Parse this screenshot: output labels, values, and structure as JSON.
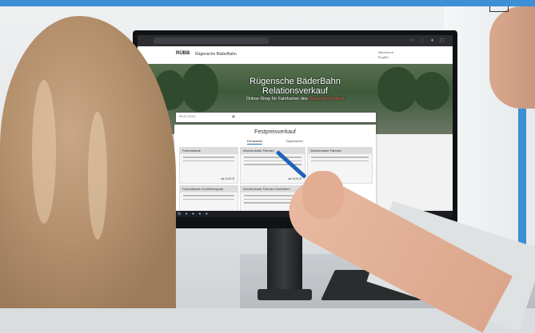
{
  "screen": {
    "site_logo": "RÜBB",
    "site_name": "Rügensche BäderBahn",
    "header_right": [
      "Warenkorb",
      "English"
    ],
    "hero_title_line1": "Rügensche BäderBahn",
    "hero_title_line2": "Relationsverkauf",
    "hero_subtitle": "Online-Shop für Fahrkarten des ",
    "hero_subtitle_accent": "Rasenden Roland",
    "search_date": "09.07.2024",
    "panel_title": "Festpreisverkauf",
    "tabs": [
      "Fahrkarten",
      "Tageskarten"
    ],
    "cards": [
      {
        "title": "Fahrradkarte",
        "price": "ab 3,00 €"
      },
      {
        "title": "Wochenkarte Fahrrad",
        "price": "ab 5,00 €"
      },
      {
        "title": "Wochenkarte Fahrrad",
        "price": ""
      },
      {
        "title": "Fahrradkarte Großelternpaar",
        "price": ""
      },
      {
        "title": "Wochenkarte Fahrrad Großeltern",
        "price": ""
      }
    ]
  },
  "colors": {
    "top_bar": "#3d8fd6",
    "pen": "#1f62b8",
    "hero_accent": "#e05c4a"
  }
}
